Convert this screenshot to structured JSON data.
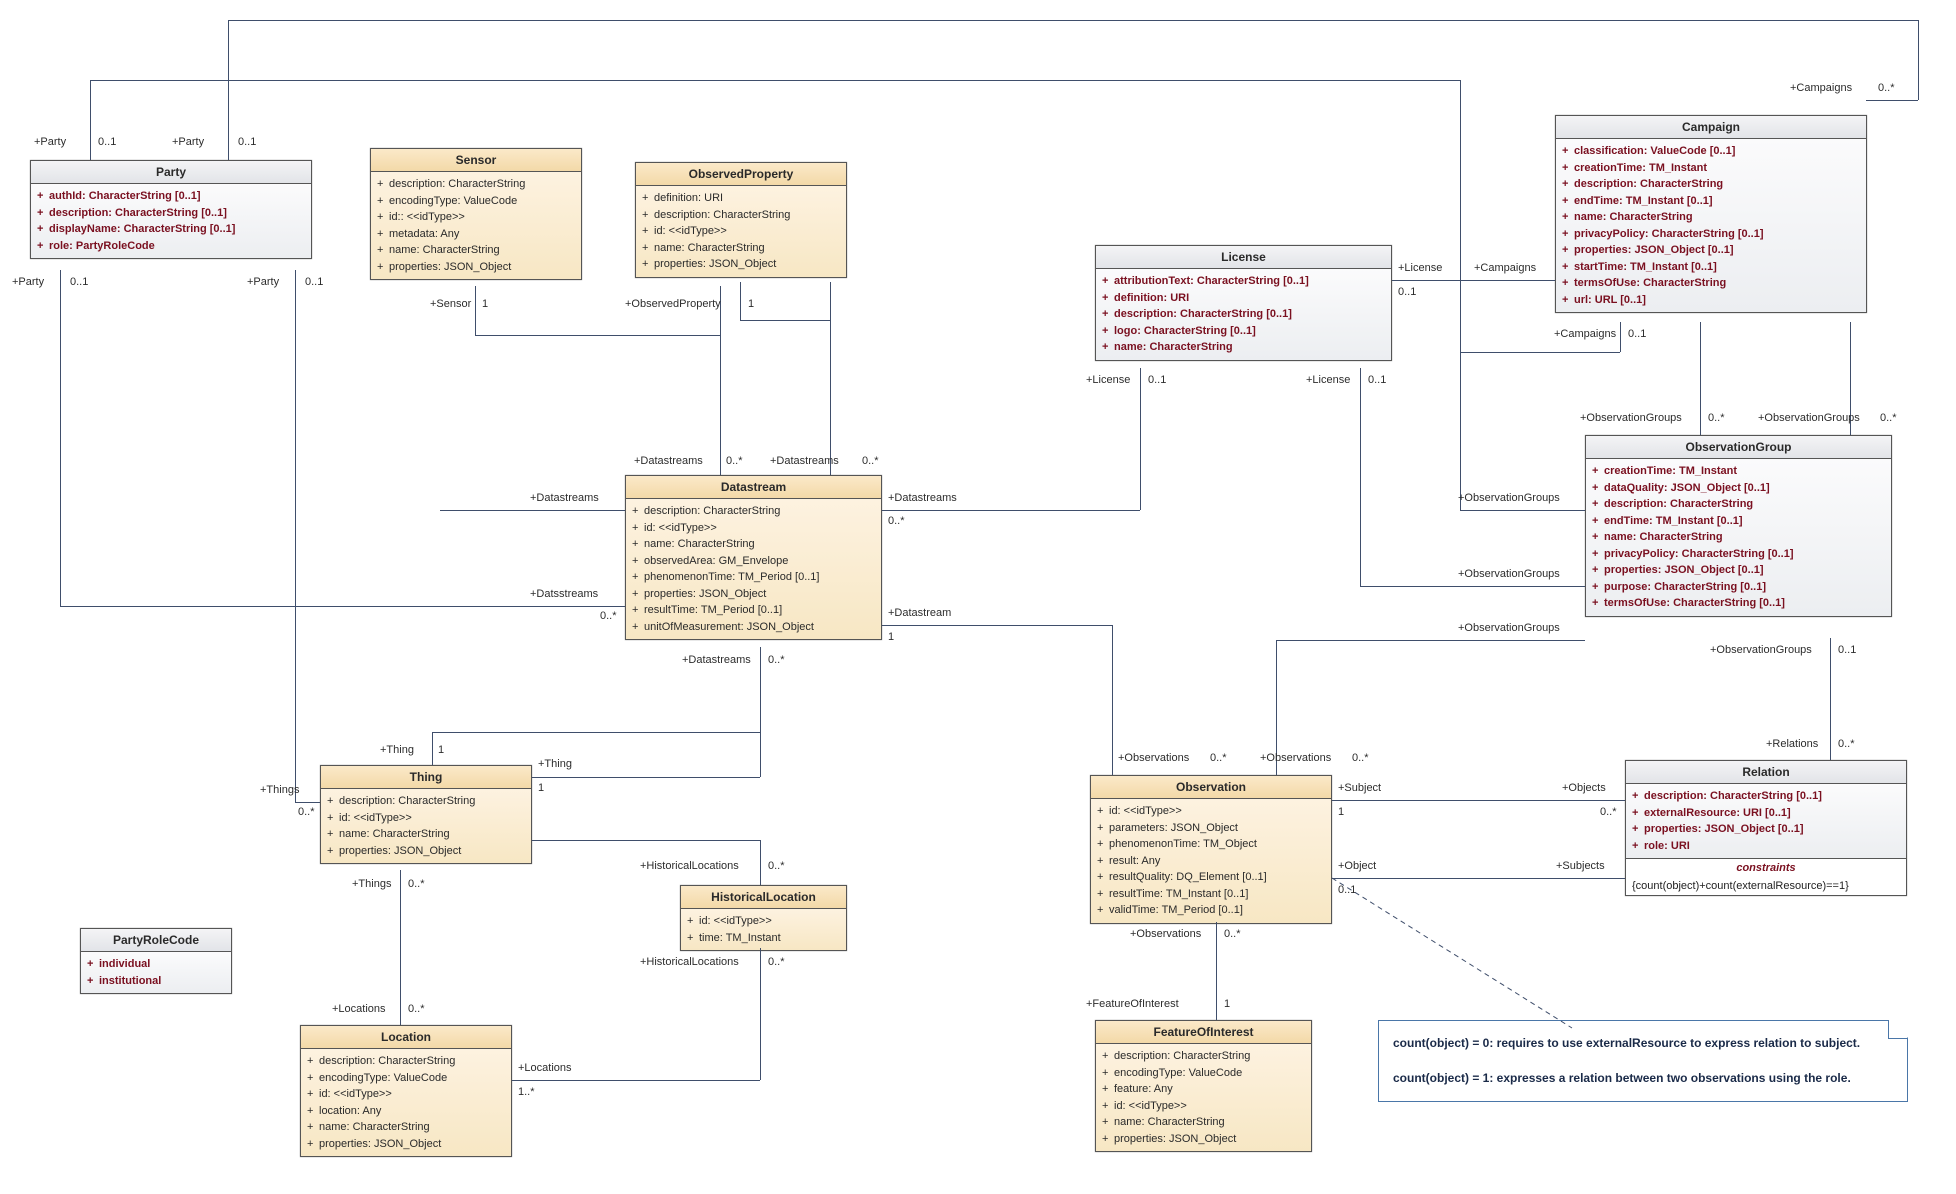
{
  "classes": {
    "party": {
      "name": "Party",
      "attrs": [
        "authId: CharacterString [0..1]",
        "description: CharacterString [0..1]",
        "displayName: CharacterString [0..1]",
        "role: PartyRoleCode"
      ]
    },
    "sensor": {
      "name": "Sensor",
      "attrs": [
        "description: CharacterString",
        "encodingType: ValueCode",
        "id:: <<idType>>",
        "metadata: Any",
        "name: CharacterString",
        "properties: JSON_Object"
      ]
    },
    "observedProperty": {
      "name": "ObservedProperty",
      "attrs": [
        "definition: URI",
        "description: CharacterString",
        "id: <<idType>>",
        "name: CharacterString",
        "properties: JSON_Object"
      ]
    },
    "license": {
      "name": "License",
      "attrs": [
        "attributionText: CharacterString [0..1]",
        "definition: URI",
        "description: CharacterString [0..1]",
        "logo: CharacterString [0..1]",
        "name: CharacterString"
      ]
    },
    "campaign": {
      "name": "Campaign",
      "attrs": [
        "classification: ValueCode [0..1]",
        "creationTime: TM_Instant",
        "description: CharacterString",
        "endTime: TM_Instant [0..1]",
        "name: CharacterString",
        "privacyPolicy: CharacterString [0..1]",
        "properties: JSON_Object [0..1]",
        "startTime: TM_Instant [0..1]",
        "termsOfUse: CharacterString",
        "url: URL [0..1]"
      ]
    },
    "datastream": {
      "name": "Datastream",
      "attrs": [
        "description: CharacterString",
        "id: <<idType>>",
        "name: CharacterString",
        "observedArea: GM_Envelope",
        "phenomenonTime: TM_Period [0..1]",
        "properties: JSON_Object",
        "resultTime: TM_Period [0..1]",
        "unitOfMeasurement: JSON_Object"
      ]
    },
    "observationGroup": {
      "name": "ObservationGroup",
      "attrs": [
        "creationTime: TM_Instant",
        "dataQuality: JSON_Object [0..1]",
        "description: CharacterString",
        "endTime: TM_Instant [0..1]",
        "name: CharacterString",
        "privacyPolicy: CharacterString [0..1]",
        "properties: JSON_Object [0..1]",
        "purpose: CharacterString [0..1]",
        "termsOfUse: CharacterString [0..1]"
      ]
    },
    "thing": {
      "name": "Thing",
      "attrs": [
        "description: CharacterString",
        "id: <<idType>>",
        "name: CharacterString",
        "properties: JSON_Object"
      ]
    },
    "historicalLocation": {
      "name": "HistoricalLocation",
      "attrs": [
        "id: <<idType>>",
        "time: TM_Instant"
      ]
    },
    "observation": {
      "name": "Observation",
      "attrs": [
        "id: <<idType>>",
        "parameters: JSON_Object",
        "phenomenonTime: TM_Object",
        "result: Any",
        "resultQuality: DQ_Element [0..1]",
        "resultTime: TM_Instant [0..1]",
        "validTime: TM_Period [0..1]"
      ]
    },
    "relation": {
      "name": "Relation",
      "attrs": [
        "description: CharacterString [0..1]",
        "externalResource: URI [0..1]",
        "properties: JSON_Object [0..1]",
        "role: URI"
      ],
      "constraintsTitle": "constraints",
      "constraintsBody": "{count(object)+count(externalResource)==1}"
    },
    "partyRoleCode": {
      "name": "PartyRoleCode",
      "attrs": [
        "individual",
        "institutional"
      ]
    },
    "location": {
      "name": "Location",
      "attrs": [
        "description: CharacterString",
        "encodingType: ValueCode",
        "id: <<idType>>",
        "location: Any",
        "name: CharacterString",
        "properties: JSON_Object"
      ]
    },
    "featureOfInterest": {
      "name": "FeatureOfInterest",
      "attrs": [
        "description: CharacterString",
        "encodingType: ValueCode",
        "feature: Any",
        "id: <<idType>>",
        "name: CharacterString",
        "properties: JSON_Object"
      ]
    }
  },
  "note": {
    "line1": "count(object) = 0: requires to use externalResource to express relation to subject.",
    "line2": "count(object) = 1: expresses a relation between two observations using the role."
  },
  "labels": {
    "party1": "+Party",
    "m01": "0..1",
    "m0s": "0..*",
    "m1": "1",
    "m1s": "1..*",
    "sensor": "+Sensor",
    "obsProp": "+ObservedProperty",
    "datastreams": "+Datastreams",
    "datastream": "+Datastream",
    "datsstreams": "+Datsstreams",
    "thing": "+Thing",
    "things": "+Things",
    "locations": "+Locations",
    "histLoc": "+HistoricalLocations",
    "observations": "+Observations",
    "foi": "+FeatureOfInterest",
    "license": "+License",
    "campaigns": "+Campaigns",
    "obsGroups": "+ObservationGroups",
    "relations": "+Relations",
    "subject": "+Subject",
    "subjects": "+Subjects",
    "objects": "+Objects",
    "object": "+Object"
  }
}
